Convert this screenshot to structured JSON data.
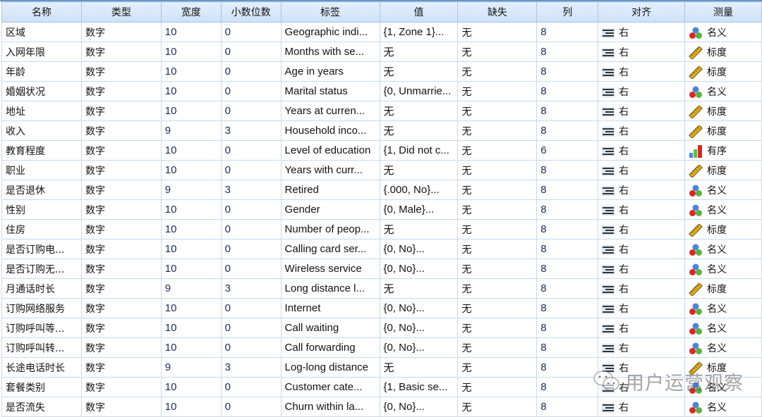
{
  "columns": [
    "名称",
    "类型",
    "宽度",
    "小数位数",
    "标签",
    "值",
    "缺失",
    "列",
    "对齐",
    "测量"
  ],
  "rows": [
    {
      "name": "区域",
      "type": "数字",
      "width": "10",
      "decimals": "0",
      "label": "Geographic indi...",
      "values": "{1, Zone 1}...",
      "missing": "无",
      "columns": "8",
      "align": "右",
      "measure": "名义",
      "measure_icon": "nominal-icon"
    },
    {
      "name": "入网年限",
      "type": "数字",
      "width": "10",
      "decimals": "0",
      "label": "Months with se...",
      "values": "无",
      "missing": "无",
      "columns": "8",
      "align": "右",
      "measure": "标度",
      "measure_icon": "scale-icon"
    },
    {
      "name": "年龄",
      "type": "数字",
      "width": "10",
      "decimals": "0",
      "label": "Age in years",
      "values": "无",
      "missing": "无",
      "columns": "8",
      "align": "右",
      "measure": "标度",
      "measure_icon": "scale-icon"
    },
    {
      "name": "婚姻状况",
      "type": "数字",
      "width": "10",
      "decimals": "0",
      "label": "Marital status",
      "values": "{0, Unmarrie...",
      "missing": "无",
      "columns": "8",
      "align": "右",
      "measure": "名义",
      "measure_icon": "nominal-icon"
    },
    {
      "name": "地址",
      "type": "数字",
      "width": "10",
      "decimals": "0",
      "label": "Years at curren...",
      "values": "无",
      "missing": "无",
      "columns": "8",
      "align": "右",
      "measure": "标度",
      "measure_icon": "scale-icon"
    },
    {
      "name": "收入",
      "type": "数字",
      "width": "9",
      "decimals": "3",
      "label": "Household inco...",
      "values": "无",
      "missing": "无",
      "columns": "8",
      "align": "右",
      "measure": "标度",
      "measure_icon": "scale-icon"
    },
    {
      "name": "教育程度",
      "type": "数字",
      "width": "10",
      "decimals": "0",
      "label": "Level of education",
      "values": "{1, Did not c...",
      "missing": "无",
      "columns": "6",
      "align": "右",
      "measure": "有序",
      "measure_icon": "ordinal-icon"
    },
    {
      "name": "职业",
      "type": "数字",
      "width": "10",
      "decimals": "0",
      "label": "Years with curr...",
      "values": "无",
      "missing": "无",
      "columns": "8",
      "align": "右",
      "measure": "标度",
      "measure_icon": "scale-icon"
    },
    {
      "name": "是否退休",
      "type": "数字",
      "width": "9",
      "decimals": "3",
      "label": "Retired",
      "values": "{.000, No}...",
      "missing": "无",
      "columns": "8",
      "align": "右",
      "measure": "名义",
      "measure_icon": "nominal-icon"
    },
    {
      "name": "性别",
      "type": "数字",
      "width": "10",
      "decimals": "0",
      "label": "Gender",
      "values": "{0, Male}...",
      "missing": "无",
      "columns": "8",
      "align": "右",
      "measure": "名义",
      "measure_icon": "nominal-icon"
    },
    {
      "name": "住房",
      "type": "数字",
      "width": "10",
      "decimals": "0",
      "label": "Number of peop...",
      "values": "无",
      "missing": "无",
      "columns": "8",
      "align": "右",
      "measure": "标度",
      "measure_icon": "scale-icon"
    },
    {
      "name": "是否订购电...",
      "type": "数字",
      "width": "10",
      "decimals": "0",
      "label": "Calling card ser...",
      "values": "{0, No}...",
      "missing": "无",
      "columns": "8",
      "align": "右",
      "measure": "名义",
      "measure_icon": "nominal-icon"
    },
    {
      "name": "是否订购无...",
      "type": "数字",
      "width": "10",
      "decimals": "0",
      "label": "Wireless service",
      "values": "{0, No}...",
      "missing": "无",
      "columns": "8",
      "align": "右",
      "measure": "名义",
      "measure_icon": "nominal-icon"
    },
    {
      "name": "月通话时长",
      "type": "数字",
      "width": "9",
      "decimals": "3",
      "label": "Long distance l...",
      "values": "无",
      "missing": "无",
      "columns": "8",
      "align": "右",
      "measure": "标度",
      "measure_icon": "scale-icon"
    },
    {
      "name": "订购网络服务",
      "type": "数字",
      "width": "10",
      "decimals": "0",
      "label": "Internet",
      "values": "{0, No}...",
      "missing": "无",
      "columns": "8",
      "align": "右",
      "measure": "名义",
      "measure_icon": "nominal-icon"
    },
    {
      "name": "订购呼叫等...",
      "type": "数字",
      "width": "10",
      "decimals": "0",
      "label": "Call waiting",
      "values": "{0, No}...",
      "missing": "无",
      "columns": "8",
      "align": "右",
      "measure": "名义",
      "measure_icon": "nominal-icon"
    },
    {
      "name": "订购呼叫转...",
      "type": "数字",
      "width": "10",
      "decimals": "0",
      "label": "Call forwarding",
      "values": "{0, No}...",
      "missing": "无",
      "columns": "8",
      "align": "右",
      "measure": "名义",
      "measure_icon": "nominal-icon"
    },
    {
      "name": "长途电话时长",
      "type": "数字",
      "width": "9",
      "decimals": "3",
      "label": "Log-long distance",
      "values": "无",
      "missing": "无",
      "columns": "8",
      "align": "右",
      "measure": "标度",
      "measure_icon": "scale-icon"
    },
    {
      "name": "套餐类别",
      "type": "数字",
      "width": "10",
      "decimals": "0",
      "label": "Customer cate...",
      "values": "{1, Basic se...",
      "missing": "无",
      "columns": "8",
      "align": "右",
      "measure": "名义",
      "measure_icon": "nominal-icon"
    },
    {
      "name": "是否流失",
      "type": "数字",
      "width": "10",
      "decimals": "0",
      "label": "Churn within la...",
      "values": "{0, No}...",
      "missing": "无",
      "columns": "8",
      "align": "右",
      "measure": "名义",
      "measure_icon": "nominal-icon"
    }
  ],
  "watermark": "用户运营观察",
  "colors": {
    "header_bg": "#d6e6f8",
    "grid": "#c6daf0",
    "number_text": "#1a2a5a"
  }
}
